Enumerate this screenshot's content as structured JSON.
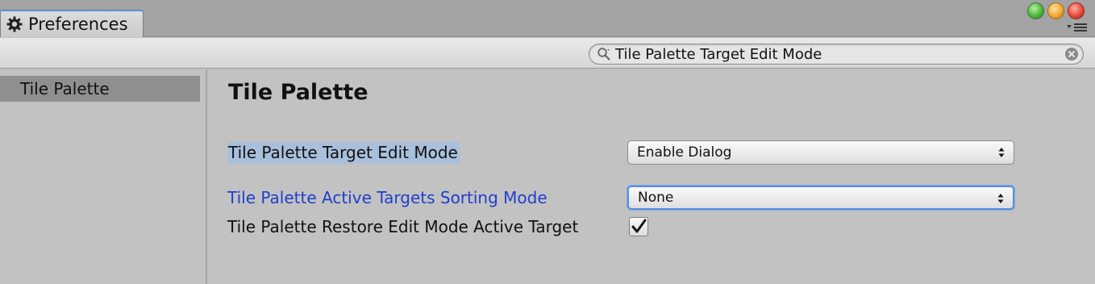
{
  "window": {
    "tab_title": "Preferences",
    "tab_icon": "gear-icon",
    "traffic_lights": {
      "green": "#4cb53a",
      "orange": "#f0a632",
      "red": "#e6483a"
    }
  },
  "toolbar": {
    "search": {
      "value": "Tile Palette Target Edit Mode",
      "icon": "search-icon",
      "clear_icon": "clear-icon"
    }
  },
  "sidebar": {
    "items": [
      {
        "label": "Tile Palette",
        "selected": true
      }
    ]
  },
  "main": {
    "title": "Tile Palette",
    "settings": [
      {
        "label": "Tile Palette Target Edit Mode",
        "control": "dropdown",
        "value": "Enable Dialog",
        "highlighted": true
      },
      {
        "label": "Tile Palette Active Targets Sorting Mode",
        "control": "dropdown",
        "value": "None",
        "focused": true
      },
      {
        "label": "Tile Palette Restore Edit Mode Active Target",
        "control": "checkbox",
        "checked": true
      }
    ]
  },
  "colors": {
    "accent": "#5a8fd8",
    "focused_label": "#1f3fce",
    "search_highlight": "#a9c0dc",
    "selected_sidebar": "#8f8f8f"
  }
}
